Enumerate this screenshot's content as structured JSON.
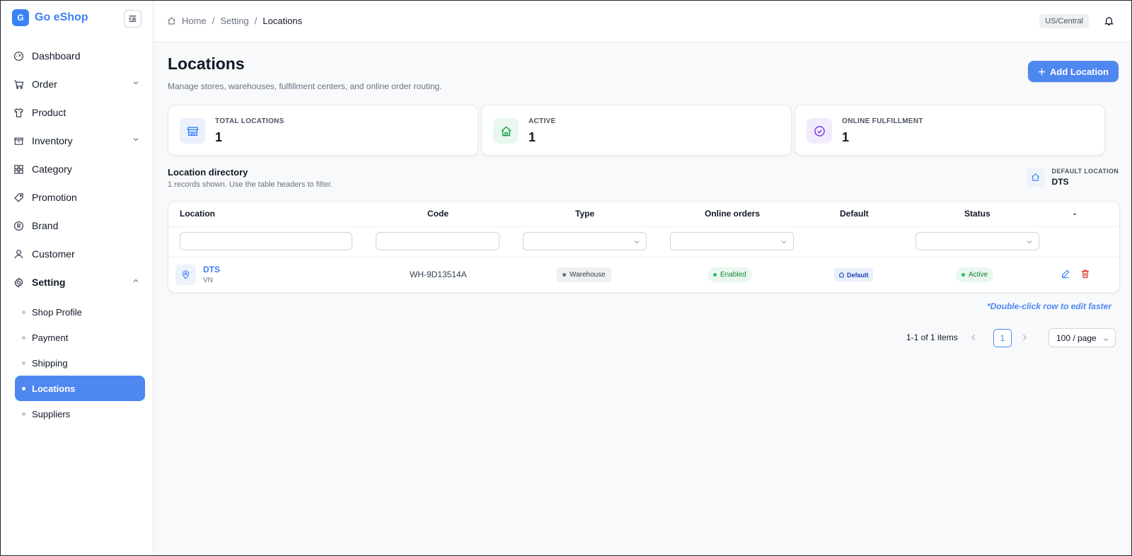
{
  "brand": {
    "logo_letter": "G",
    "name": "Go eShop"
  },
  "sidebar": {
    "items": [
      {
        "label": "Dashboard",
        "icon": "dashboard-icon"
      },
      {
        "label": "Order",
        "icon": "cart-icon",
        "expandable": true
      },
      {
        "label": "Product",
        "icon": "shirt-icon"
      },
      {
        "label": "Inventory",
        "icon": "box-icon",
        "expandable": true
      },
      {
        "label": "Category",
        "icon": "grid-icon"
      },
      {
        "label": "Promotion",
        "icon": "tag-icon"
      },
      {
        "label": "Brand",
        "icon": "registered-icon"
      },
      {
        "label": "Customer",
        "icon": "user-icon"
      },
      {
        "label": "Setting",
        "icon": "gear-icon",
        "expanded": true
      }
    ],
    "setting_children": [
      "Shop Profile",
      "Payment",
      "Shipping",
      "Locations",
      "Suppliers"
    ],
    "active_child": "Locations"
  },
  "header": {
    "breadcrumb": [
      "Home",
      "Setting",
      "Locations"
    ],
    "separator": "/",
    "timezone": "US/Central"
  },
  "page": {
    "title": "Locations",
    "subtitle": "Manage stores, warehouses, fulfillment centers, and online order routing.",
    "add_button": "Add Location"
  },
  "stats": [
    {
      "label": "TOTAL LOCATIONS",
      "value": "1",
      "icon": "store-icon",
      "color": "#3b82f6",
      "bg": "#eaf1fd"
    },
    {
      "label": "ACTIVE",
      "value": "1",
      "icon": "home-icon",
      "color": "#16a34a",
      "bg": "#e9f7ee"
    },
    {
      "label": "ONLINE FULFILLMENT",
      "value": "1",
      "icon": "check-circle-icon",
      "color": "#7c3aed",
      "bg": "#f1ebfd"
    }
  ],
  "directory": {
    "title": "Location directory",
    "subtitle": "1 records shown. Use the table headers to filter.",
    "default_label": "DEFAULT LOCATION",
    "default_value": "DTS"
  },
  "table": {
    "columns": [
      "Location",
      "Code",
      "Type",
      "Online orders",
      "Default",
      "Status",
      "-"
    ],
    "rows": [
      {
        "name": "DTS",
        "country": "VN",
        "code": "WH-9D13514A",
        "type": "Warehouse",
        "online_orders": "Enabled",
        "default": "Default",
        "status": "Active"
      }
    ],
    "hint": "*Double-click row to edit faster"
  },
  "pagination": {
    "summary": "1-1 of 1 items",
    "current_page": "1",
    "page_size": "100 / page"
  },
  "colors": {
    "accent": "#4f87f0",
    "success": "#16a34a",
    "danger": "#dc2626"
  }
}
